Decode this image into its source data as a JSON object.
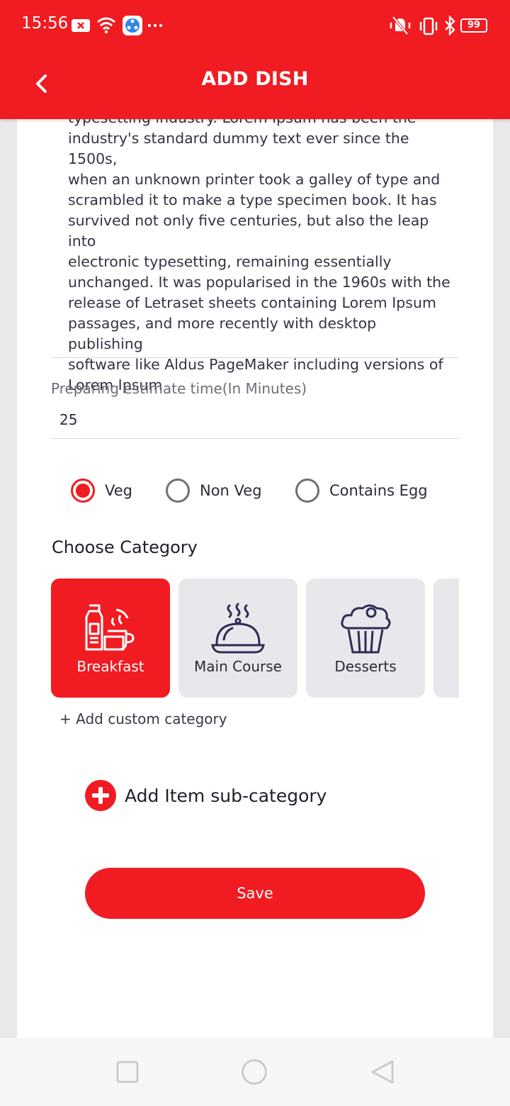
{
  "status_bar": {
    "time": "15:56",
    "battery": "99",
    "icons": [
      "notification-x-icon",
      "wifi-icon",
      "share-app-icon",
      "more-dots-icon",
      "mute-vibrate-icon",
      "vibrate-icon",
      "bluetooth-icon",
      "battery-icon"
    ]
  },
  "header": {
    "title": "ADD DISH",
    "back_icon": "chevron-left-icon"
  },
  "description": {
    "text": "typesetting industry. Lorem Ipsum has been the\nindustry's standard dummy text ever since the 1500s,\nwhen an unknown printer took a galley of type and\nscrambled it to make a type specimen book. It has\nsurvived not only five centuries, but also the leap into\nelectronic typesetting, remaining essentially\nunchanged. It was popularised in the 1960s with the\nrelease of Letraset sheets containing Lorem Ipsum\npassages, and more recently with desktop publishing\nsoftware like Aldus PageMaker including versions of\nLorem Ipsum"
  },
  "prep_time": {
    "label": "Preparing estimate time(In Minutes)",
    "value": "25"
  },
  "food_type": {
    "options": [
      {
        "label": "Veg",
        "checked": true
      },
      {
        "label": "Non Veg",
        "checked": false
      },
      {
        "label": "Contains Egg",
        "checked": false
      }
    ]
  },
  "category": {
    "title": "Choose Category",
    "items": [
      {
        "label": "Breakfast",
        "icon": "breakfast-icon",
        "selected": true
      },
      {
        "label": "Main Course",
        "icon": "cloche-icon",
        "selected": false
      },
      {
        "label": "Desserts",
        "icon": "cupcake-icon",
        "selected": false
      },
      {
        "label": "",
        "icon": "",
        "selected": false
      }
    ],
    "add_custom_label": "+ Add custom category"
  },
  "subcategory": {
    "label": "Add Item sub-category"
  },
  "save_label": "Save",
  "colors": {
    "accent": "#f11b22",
    "tile_bg": "#e8e8ec",
    "icon_navy": "#2d2d55"
  }
}
